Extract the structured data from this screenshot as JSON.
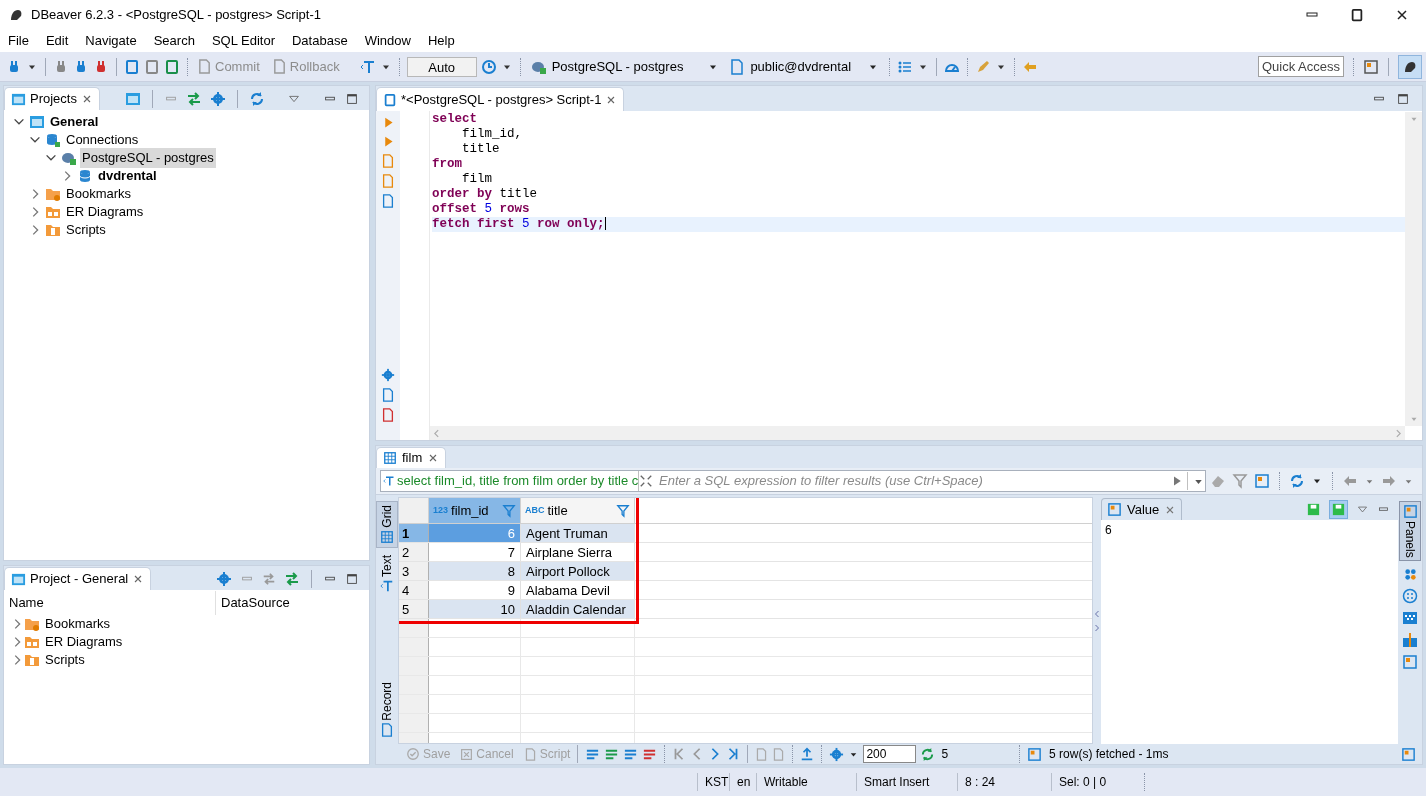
{
  "window": {
    "title": "DBeaver 6.2.3 - <PostgreSQL - postgres> Script-1"
  },
  "menu": [
    "File",
    "Edit",
    "Navigate",
    "Search",
    "SQL Editor",
    "Database",
    "Window",
    "Help"
  ],
  "toolbar": {
    "commit": "Commit",
    "rollback": "Rollback",
    "transaction_mode": "Auto",
    "connection": "PostgreSQL - postgres",
    "schema": "public@dvdrental",
    "quick_access": "Quick Access"
  },
  "projects_panel": {
    "title": "Projects",
    "tree": [
      {
        "label": "General",
        "kind": "project",
        "bold": true,
        "expanded": true,
        "selected": false,
        "children": [
          {
            "label": "Connections",
            "kind": "connections",
            "bold": false,
            "expanded": true,
            "selected": false,
            "children": [
              {
                "label": "PostgreSQL - postgres",
                "kind": "postgres",
                "bold": false,
                "expanded": true,
                "selected": true,
                "children": [
                  {
                    "label": "dvdrental",
                    "kind": "database",
                    "bold": true,
                    "expanded": false,
                    "selected": false
                  }
                ]
              }
            ]
          },
          {
            "label": "Bookmarks",
            "kind": "bookmarks",
            "bold": false,
            "expanded": false,
            "selected": false
          },
          {
            "label": "ER Diagrams",
            "kind": "er",
            "bold": false,
            "expanded": false,
            "selected": false
          },
          {
            "label": "Scripts",
            "kind": "scripts",
            "bold": false,
            "expanded": false,
            "selected": false
          }
        ]
      }
    ]
  },
  "project_general_panel": {
    "title": "Project - General",
    "columns": [
      "Name",
      "DataSource"
    ],
    "items": [
      {
        "label": "Bookmarks",
        "kind": "bookmarks",
        "expanded": false
      },
      {
        "label": "ER Diagrams",
        "kind": "er",
        "expanded": false
      },
      {
        "label": "Scripts",
        "kind": "scripts",
        "expanded": false
      }
    ]
  },
  "editor": {
    "tab": "*<PostgreSQL - postgres> Script-1",
    "lines": [
      {
        "current": false,
        "tokens": [
          {
            "kind": "keyword",
            "text": "select"
          }
        ]
      },
      {
        "current": false,
        "tokens": [
          {
            "kind": "plain",
            "text": "    film_id,"
          }
        ]
      },
      {
        "current": false,
        "tokens": [
          {
            "kind": "plain",
            "text": "    title"
          }
        ]
      },
      {
        "current": false,
        "tokens": [
          {
            "kind": "keyword",
            "text": "from"
          }
        ]
      },
      {
        "current": false,
        "tokens": [
          {
            "kind": "plain",
            "text": "    film"
          }
        ]
      },
      {
        "current": false,
        "tokens": [
          {
            "kind": "keyword",
            "text": "order by"
          },
          {
            "kind": "plain",
            "text": " title"
          }
        ]
      },
      {
        "current": false,
        "tokens": [
          {
            "kind": "keyword",
            "text": "offset"
          },
          {
            "kind": "number",
            "text": " 5"
          },
          {
            "kind": "keyword",
            "text": " rows"
          }
        ]
      },
      {
        "current": true,
        "tokens": [
          {
            "kind": "keyword",
            "text": "fetch first"
          },
          {
            "kind": "number",
            "text": " 5"
          },
          {
            "kind": "keyword",
            "text": " row only;"
          }
        ]
      }
    ]
  },
  "results": {
    "tab": "film",
    "query": "select film_id, title from film order by title c",
    "filter_placeholder": "Enter a SQL expression to filter results (use Ctrl+Space)",
    "view_tabs": [
      {
        "label": "Grid",
        "selected": true
      },
      {
        "label": "Text",
        "selected": false
      },
      {
        "label": "Record",
        "selected": false
      }
    ],
    "columns": [
      {
        "type_label": "123",
        "name": "film_id",
        "kind": "number",
        "selected": true
      },
      {
        "type_label": "ABC",
        "name": "title",
        "kind": "text",
        "selected": false
      }
    ],
    "rows": [
      {
        "number": "1",
        "cells": [
          "6",
          "Agent Truman"
        ],
        "selected": true
      },
      {
        "number": "2",
        "cells": [
          "7",
          "Airplane Sierra"
        ],
        "selected": false
      },
      {
        "number": "3",
        "cells": [
          "8",
          "Airport Pollock"
        ],
        "selected": false
      },
      {
        "number": "4",
        "cells": [
          "9",
          "Alabama Devil"
        ],
        "selected": false
      },
      {
        "number": "5",
        "cells": [
          "10",
          "Aladdin Calendar"
        ],
        "selected": false
      }
    ],
    "highlighted": true,
    "value_panel": {
      "title": "Value",
      "value": "6"
    },
    "panels_tab": "Panels",
    "bottom_bar": {
      "save": "Save",
      "cancel": "Cancel",
      "script": "Script",
      "fetch_size": "200",
      "row_count": "5",
      "fetch_status": "5 row(s) fetched - 1ms"
    }
  },
  "status_bar": [
    "KST",
    "en",
    "Writable",
    "Smart Insert",
    "8 : 24",
    "Sel: 0 | 0"
  ]
}
